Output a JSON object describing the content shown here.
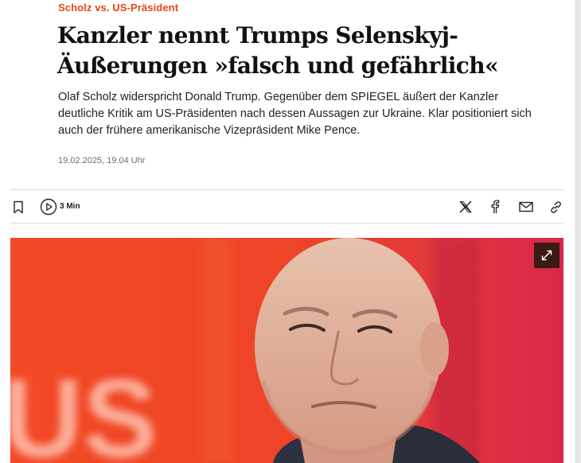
{
  "article": {
    "kicker": "Scholz vs. US-Präsident",
    "headline_line1": "Kanzler nennt Trumps Selenskyj-",
    "headline_line2": "Äußerungen »falsch und gefährlich«",
    "lead": "Olaf Scholz widerspricht Donald Trump. Gegenüber dem SPIEGEL äußert der Kanzler deutliche Kritik am US-Präsidenten nach dessen Aussagen zur Ukraine. Klar positioniert sich auch der frühere amerikanische Vizepräsident Mike Pence.",
    "dateline": "19.02.2025, 19.04 Uhr"
  },
  "toolbar": {
    "reading_time": "3 Min",
    "icons": [
      "bookmark-icon",
      "play-icon",
      "x-icon",
      "facebook-icon",
      "mail-icon",
      "link-icon"
    ]
  },
  "photo": {
    "background_text": "US",
    "icon": "expand-icon"
  },
  "colors": {
    "accent": "#e64415",
    "photo_bg": "#ee4a2a"
  }
}
